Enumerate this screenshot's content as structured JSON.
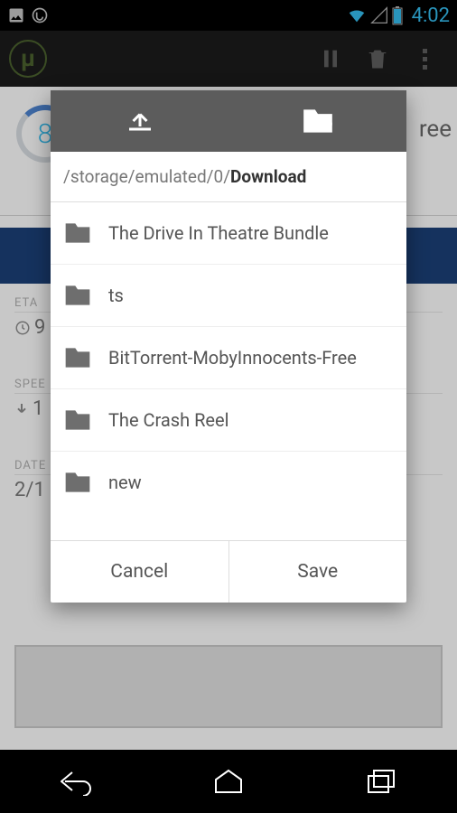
{
  "statusbar": {
    "clock": "4:02"
  },
  "actionbar": {
    "app_name": "µTorrent"
  },
  "background": {
    "progress": "8",
    "right_text": "ree",
    "eta_label": "ETA",
    "eta_value": "9",
    "speed_label": "SPEE",
    "speed_value": "1",
    "date_label": "DATE",
    "date_value": "2/1"
  },
  "dialog": {
    "path_base": "/storage/emulated/0/",
    "path_current": "Download",
    "folders": [
      {
        "name": "The Drive In Theatre Bundle"
      },
      {
        "name": "ts"
      },
      {
        "name": "BitTorrent-MobyInnocents-Free"
      },
      {
        "name": "The Crash Reel"
      },
      {
        "name": "new"
      }
    ],
    "cancel_label": "Cancel",
    "save_label": "Save"
  }
}
